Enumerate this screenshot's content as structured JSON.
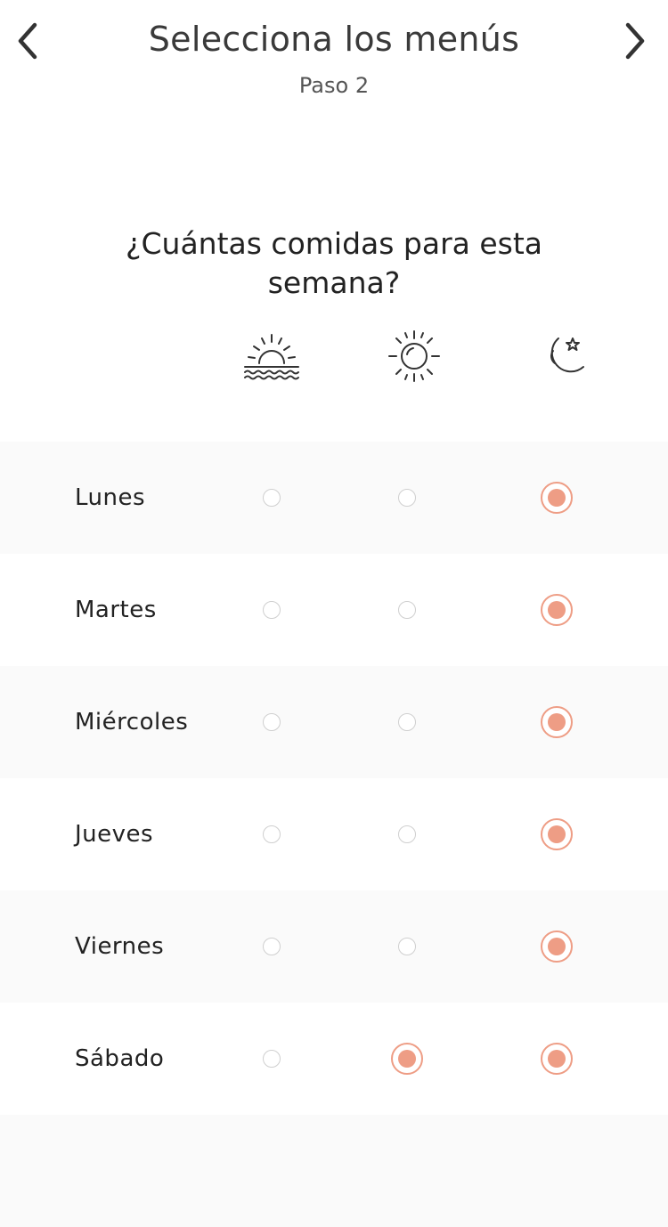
{
  "header": {
    "title": "Selecciona los menús",
    "subtitle": "Paso 2"
  },
  "question": "¿Cuántas comidas para esta semana?",
  "meal_columns": [
    {
      "icon": "sunrise-icon"
    },
    {
      "icon": "sun-icon"
    },
    {
      "icon": "moon-star-icon"
    }
  ],
  "colors": {
    "accent": "#ee9d85",
    "radio_off_border": "#cfcfcf",
    "row_shade": "#fafafa"
  },
  "days": [
    {
      "label": "Lunes",
      "selected": [
        false,
        false,
        true
      ]
    },
    {
      "label": "Martes",
      "selected": [
        false,
        false,
        true
      ]
    },
    {
      "label": "Miércoles",
      "selected": [
        false,
        false,
        true
      ]
    },
    {
      "label": "Jueves",
      "selected": [
        false,
        false,
        true
      ]
    },
    {
      "label": "Viernes",
      "selected": [
        false,
        false,
        true
      ]
    },
    {
      "label": "Sábado",
      "selected": [
        false,
        true,
        true
      ]
    }
  ]
}
